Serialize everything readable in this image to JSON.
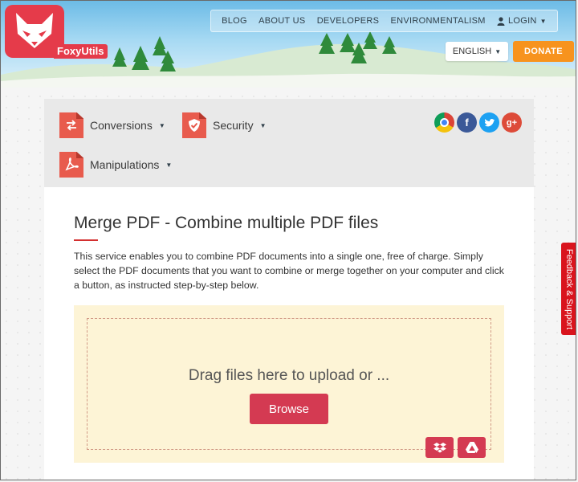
{
  "brand": {
    "name": "FoxyUtils"
  },
  "nav": {
    "items": [
      "BLOG",
      "ABOUT US",
      "DEVELOPERS",
      "ENVIRONMENTALISM"
    ],
    "login": "LOGIN"
  },
  "language": "ENGLISH",
  "donate": "DONATE",
  "tools": {
    "conversions": "Conversions",
    "security": "Security",
    "manipulations": "Manipulations"
  },
  "social": [
    "chrome-icon",
    "facebook-icon",
    "twitter-icon",
    "google-plus-icon"
  ],
  "page": {
    "title": "Merge PDF - Combine multiple PDF files",
    "intro": "This service enables you to combine PDF documents into a single one, free of charge. Simply select the PDF documents that you want to combine or merge together on your computer and click a button, as instructed step-by-step below."
  },
  "upload": {
    "drag_text": "Drag files here to upload or ...",
    "browse": "Browse"
  },
  "feedback": "Feedback & Support",
  "colors": {
    "accent": "#e53b4a",
    "button": "#d43a52",
    "donate": "#f7931e",
    "dropzone": "#fdf4d6"
  }
}
